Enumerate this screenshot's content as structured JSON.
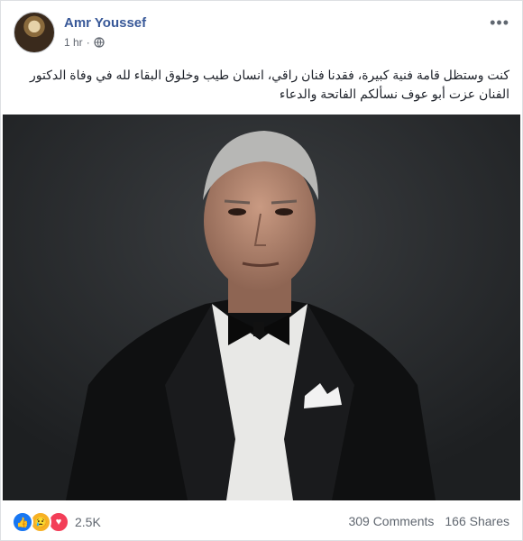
{
  "post": {
    "author": "Amr Youssef",
    "time": "1 hr",
    "privacy_icon": "globe-icon",
    "text": "كنت وستظل قامة فنية كبيرة، فقدنا فنان راقي، انسان طيب وخلوق البقاء لله في وفاة الدكتور الفنان عزت أبو عوف نسألكم الفاتحة والدعاء",
    "image_alt": "Portrait of a man in a black tuxedo with a bow tie"
  },
  "footer": {
    "reaction_icons": [
      "like-icon",
      "sad-icon",
      "love-icon"
    ],
    "reaction_count": "2.5K",
    "comments": "309 Comments",
    "shares": "166 Shares"
  },
  "colors": {
    "author_link": "#385898",
    "like": "#1877f2",
    "sad": "#f7b125",
    "love": "#f33e58"
  }
}
